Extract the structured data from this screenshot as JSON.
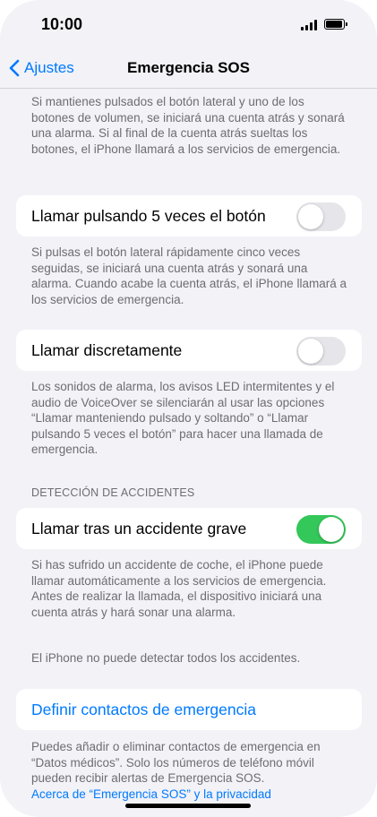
{
  "status_bar": {
    "time": "10:00"
  },
  "nav": {
    "back_label": "Ajustes",
    "title": "Emergencia SOS"
  },
  "intro_text": "Si mantienes pulsados el botón lateral y uno de los botones de volumen, se iniciará una cuenta atrás y sonará una alarma. Si al final de la cuenta atrás sueltas los botones, el iPhone llamará a los servicios de emergencia.",
  "settings": [
    {
      "label": "Llamar pulsando 5 veces el botón",
      "enabled": false,
      "footer": "Si pulsas el botón lateral rápidamente cinco veces seguidas, se iniciará una cuenta atrás y sonará una alarma. Cuando acabe la cuenta atrás, el iPhone llamará a los servicios de emergencia."
    },
    {
      "label": "Llamar discretamente",
      "enabled": false,
      "footer": "Los sonidos de alarma, los avisos LED intermitentes y el audio de VoiceOver se silenciarán al usar las opciones “Llamar manteniendo pulsado y soltando” o “Llamar pulsando 5 veces el botón” para hacer una llamada de emergencia."
    }
  ],
  "accident_section": {
    "header": "DETECCIÓN DE ACCIDENTES",
    "label": "Llamar tras un accidente grave",
    "enabled": true,
    "footer": "Si has sufrido un accidente de coche, el iPhone puede llamar automáticamente a los servicios de emergencia. Antes de realizar la llamada, el dispositivo iniciará una cuenta atrás y hará sonar una alarma.",
    "note": "El iPhone no puede detectar todos los accidentes."
  },
  "contacts": {
    "label": "Definir contactos de emergencia",
    "footer": "Puedes añadir o eliminar contactos de emergencia en “Datos médicos”. Solo los números de teléfono móvil pueden recibir alertas de Emergencia SOS.",
    "privacy_link": "Acerca de “Emergencia SOS” y la privacidad"
  }
}
